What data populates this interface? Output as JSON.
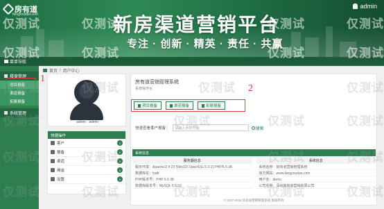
{
  "banner": {
    "logo_text": "房有道",
    "logo_sub": "fangyoudao.com",
    "user": "admin",
    "title": "新房渠道营销平台",
    "subtitle": "专注 · 创新 · 精英 · 责任 · 共赢"
  },
  "topbar": {
    "home_label": "菜单导航"
  },
  "sidebar": {
    "items": [
      {
        "label": "楼盘管理",
        "type": "group"
      },
      {
        "label": "项目报备",
        "type": "sub",
        "active": true
      },
      {
        "label": "渠道报备",
        "type": "sub",
        "active": false
      },
      {
        "label": "拓展报备",
        "type": "sub",
        "active": false
      },
      {
        "label": "系统管理",
        "type": "group"
      }
    ]
  },
  "annotations": {
    "one": "1",
    "two": "2"
  },
  "breadcrumb": {
    "home": "首页",
    "current": "用户中心"
  },
  "profile": {
    "name": "admin · admin"
  },
  "quick": {
    "title": "快捷操作",
    "rows": [
      {
        "label": "客户",
        "count": "0"
      },
      {
        "label": "报备",
        "count": "0"
      },
      {
        "label": "渠道",
        "count": "0"
      },
      {
        "label": "佣金",
        "count": "0"
      },
      {
        "label": "设置",
        "count": "0"
      }
    ]
  },
  "main": {
    "sys_title": "房有道营销管理系统",
    "sys_sub": "系统操作台",
    "buttons": [
      "项目报备",
      "渠道报备",
      "拓展报备"
    ],
    "search_label": "快速查看客户报备：",
    "search_placeholder": "请输入手机号码",
    "search_button": "搜索"
  },
  "info": {
    "head": "系统信息",
    "left_title": "服务器信息",
    "right_title": "系统信息",
    "left_lines": [
      "服务环境：Apache/2.4.23 (Win32) OpenSSL/1.0.2j PHP/5.5.38",
      "数据库名：fydb",
      "PHP版本号：PHP 5.5.38",
      "数据库版本号：MySQL 5.5.53"
    ],
    "right_lines": [
      "系统名称：房有道营销管理系统",
      "官方网站：www.fangyoudao.com",
      "用户名：demo",
      "公司名称：深圳房有道营销有限公司"
    ]
  },
  "footer": "© 2017-2018 房有道营销管理系统 版权所有",
  "watermark": "仅测试"
}
